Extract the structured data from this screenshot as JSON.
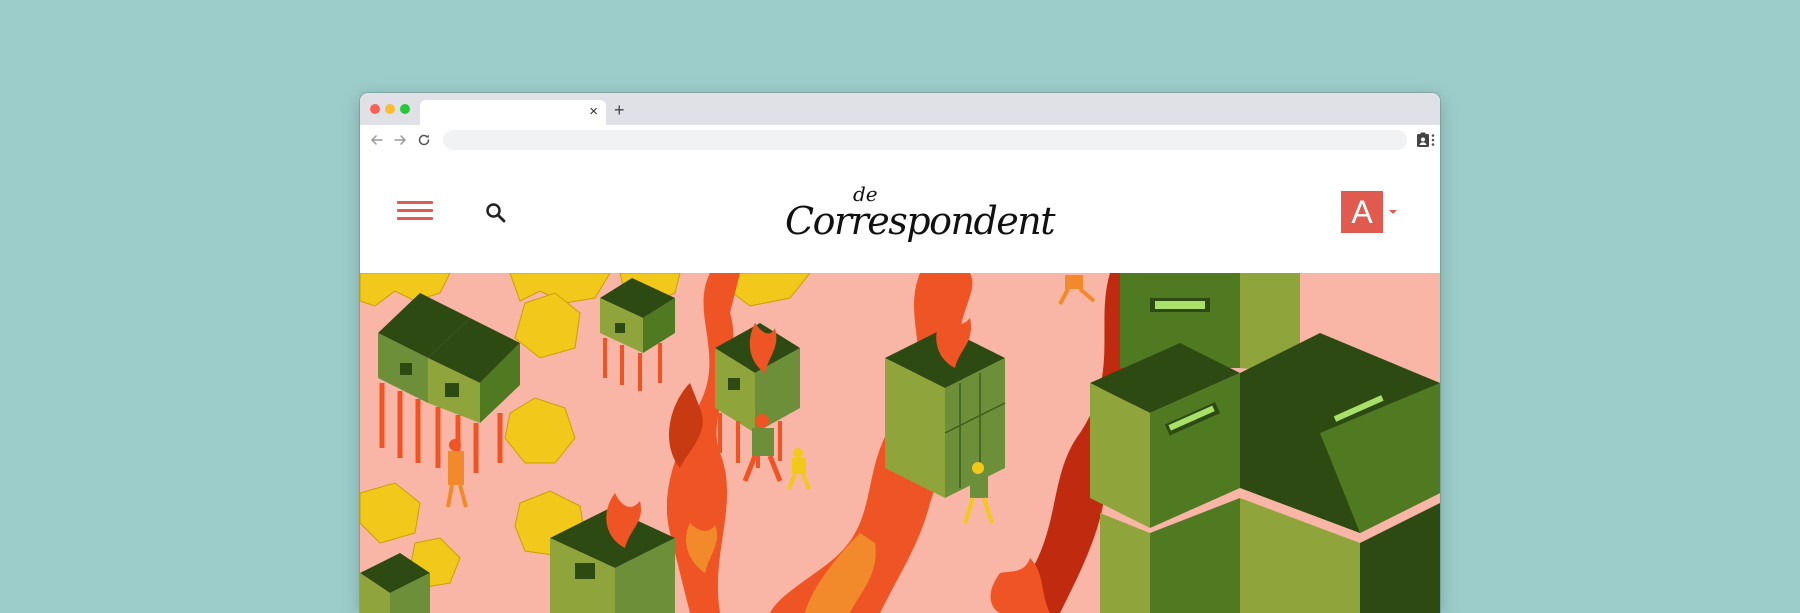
{
  "browser": {
    "tab": {
      "title": "",
      "close_glyph": "×"
    },
    "new_tab_glyph": "+",
    "address_bar": {
      "value": ""
    },
    "icons": [
      "back-arrow-icon",
      "forward-arrow-icon",
      "reload-icon",
      "extension-icon",
      "kebab-menu-icon"
    ]
  },
  "site": {
    "logo_prefix": "de",
    "logo_text": "Correspondent",
    "avatar_letter": "A",
    "icons": [
      "hamburger-menu-icon",
      "search-icon",
      "caret-down-icon"
    ]
  },
  "colors": {
    "page_background": "#9dcdca",
    "brand_accent": "#e05a50",
    "hero_background": "#f9b6a6",
    "hero_green_dark": "#2c4a12",
    "hero_green_mid": "#4f7a22",
    "hero_green_light": "#8fa53c",
    "hero_fire": "#ee5424",
    "hero_yellow": "#f2c81a"
  },
  "hero": {
    "type": "illustration",
    "subject": "isometric scene of burning stilt houses, fleeing figures and giant green filing cabinets"
  }
}
